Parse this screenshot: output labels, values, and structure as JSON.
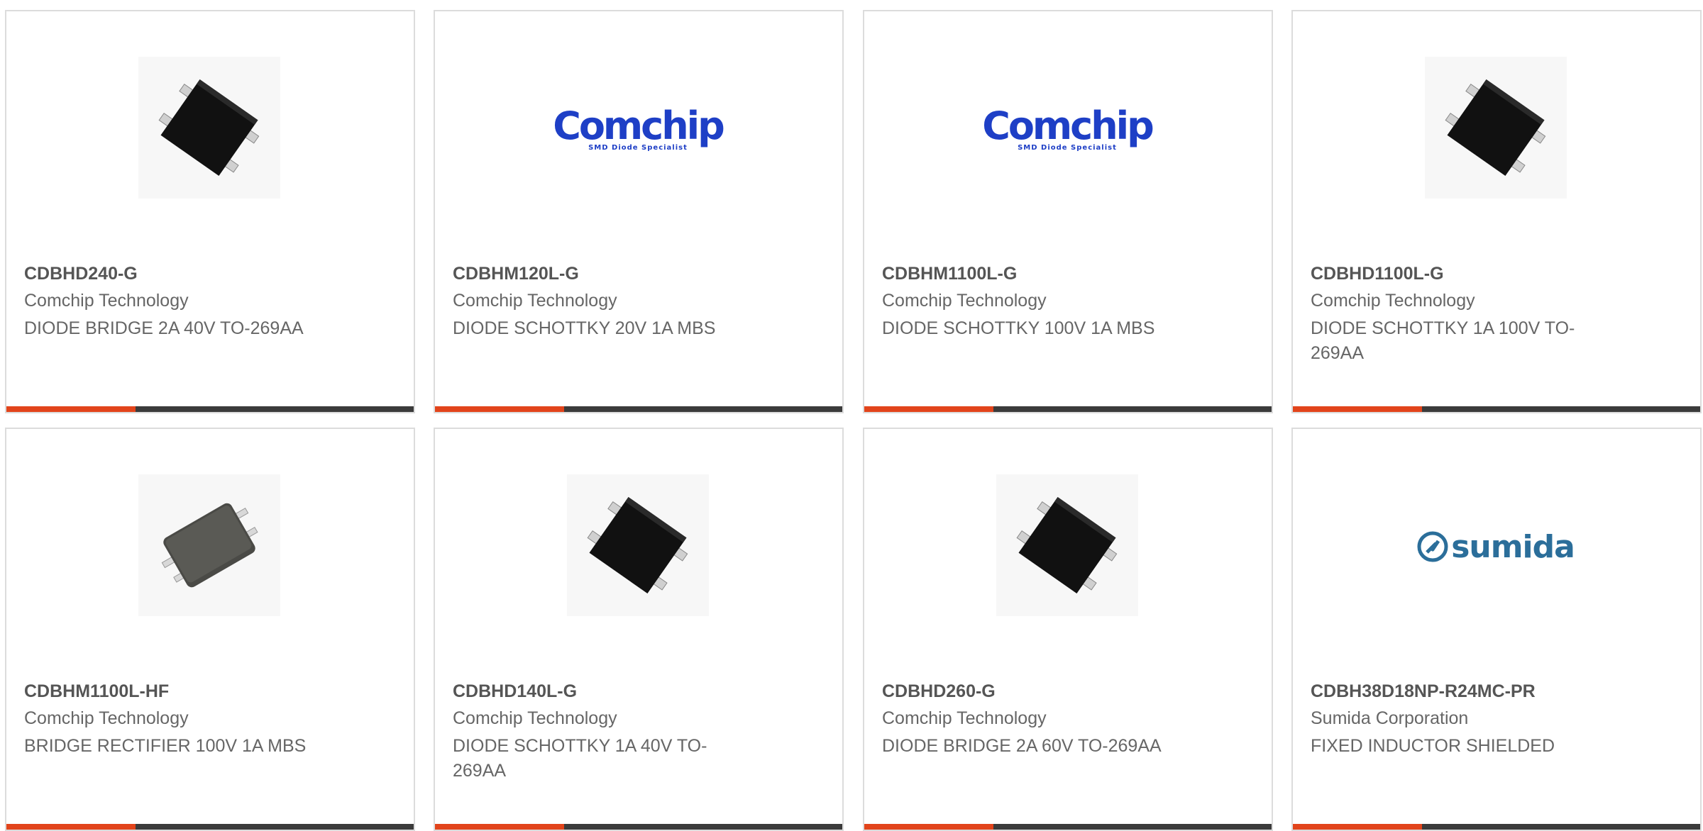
{
  "products": [
    {
      "part_number": "CDBHD240-G",
      "manufacturer": "Comchip Technology",
      "description": "DIODE BRIDGE 2A 40V TO-269AA",
      "image": "chip-photo-icon"
    },
    {
      "part_number": "CDBHM120L-G",
      "manufacturer": "Comchip Technology",
      "description": "DIODE SCHOTTKY 20V 1A MBS",
      "image": "comchip-logo",
      "logo_text": "Comchip",
      "logo_tagline": "SMD Diode Specialist"
    },
    {
      "part_number": "CDBHM1100L-G",
      "manufacturer": "Comchip Technology",
      "description": "DIODE SCHOTTKY 100V 1A MBS",
      "image": "comchip-logo",
      "logo_text": "Comchip",
      "logo_tagline": "SMD Diode Specialist"
    },
    {
      "part_number": "CDBHD1100L-G",
      "manufacturer": "Comchip Technology",
      "description": "DIODE SCHOTTKY 1A 100V TO-269AA",
      "image": "chip-photo-icon"
    },
    {
      "part_number": "CDBHM1100L-HF",
      "manufacturer": "Comchip Technology",
      "description": "BRIDGE RECTIFIER 100V 1A MBS",
      "image": "chip-photo-small-icon"
    },
    {
      "part_number": "CDBHD140L-G",
      "manufacturer": "Comchip Technology",
      "description": "DIODE SCHOTTKY 1A 40V TO-269AA",
      "image": "chip-photo-icon"
    },
    {
      "part_number": "CDBHD260-G",
      "manufacturer": "Comchip Technology",
      "description": "DIODE BRIDGE 2A 60V TO-269AA",
      "image": "chip-photo-icon"
    },
    {
      "part_number": "CDBH38D18NP-R24MC-PR",
      "manufacturer": "Sumida Corporation",
      "description": "FIXED INDUCTOR SHIELDED",
      "image": "sumida-logo",
      "logo_text": "sumida"
    }
  ],
  "colors": {
    "accent": "#e2441b",
    "bar": "#3b3b3b",
    "comchip_blue": "#1e3fc6",
    "sumida_blue": "#2b6e9a"
  }
}
